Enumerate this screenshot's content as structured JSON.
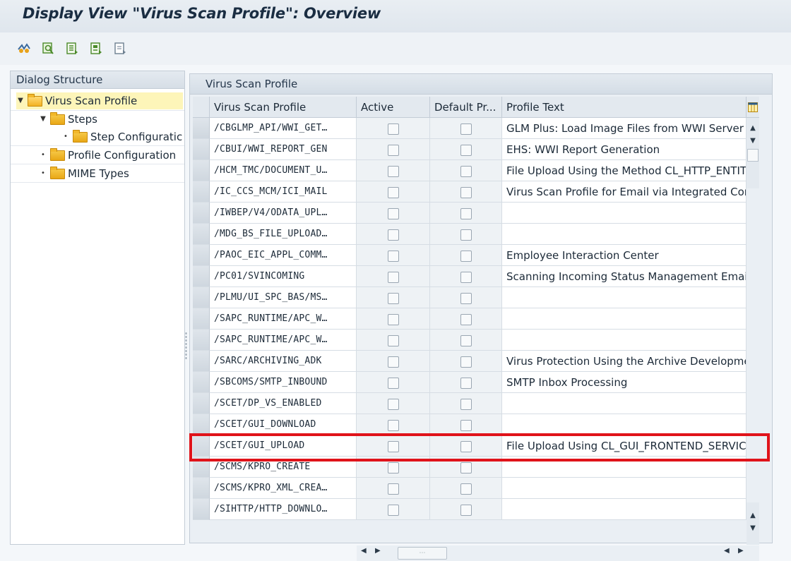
{
  "window": {
    "title": "Display View \"Virus Scan Profile\": Overview"
  },
  "toolbar": {
    "icons": [
      "other-view-icon",
      "details-icon",
      "select-all-icon",
      "select-block-icon",
      "deselect-all-icon"
    ]
  },
  "dialog_structure": {
    "header": "Dialog Structure",
    "items": [
      {
        "label": "Virus Scan Profile",
        "level": 0,
        "expanded": true,
        "selected": true
      },
      {
        "label": "Steps",
        "level": 1,
        "expanded": true,
        "selected": false
      },
      {
        "label": "Step Configuratic",
        "level": 2,
        "expanded": false,
        "selected": false
      },
      {
        "label": "Profile Configuration",
        "level": 1,
        "expanded": false,
        "selected": false
      },
      {
        "label": "MIME Types",
        "level": 1,
        "expanded": false,
        "selected": false
      }
    ]
  },
  "grid": {
    "panel_title": "Virus Scan Profile",
    "columns": [
      "Virus Scan Profile",
      "Active",
      "Default Pr...",
      "Profile Text"
    ],
    "rows": [
      {
        "profile": "/CBGLMP_API/WWI_GET…",
        "active": false,
        "default": false,
        "text": "GLM Plus: Load Image Files from WWI Server"
      },
      {
        "profile": "/CBUI/WWI_REPORT_GEN",
        "active": false,
        "default": false,
        "text": "EHS: WWI Report Generation"
      },
      {
        "profile": "/HCM_TMC/DOCUMENT_U…",
        "active": false,
        "default": false,
        "text": "File Upload Using the Method CL_HTTP_ENTIT"
      },
      {
        "profile": "/IC_CCS_MCM/ICI_MAIL",
        "active": false,
        "default": false,
        "text": "Virus Scan Profile for Email via Integrated Com"
      },
      {
        "profile": "/IWBEP/V4/ODATA_UPL…",
        "active": false,
        "default": false,
        "text": ""
      },
      {
        "profile": "/MDG_BS_FILE_UPLOAD…",
        "active": false,
        "default": false,
        "text": ""
      },
      {
        "profile": "/PAOC_EIC_APPL_COMM…",
        "active": false,
        "default": false,
        "text": "Employee Interaction Center"
      },
      {
        "profile": "/PC01/SVINCOMING",
        "active": false,
        "default": false,
        "text": "Scanning Incoming Status Management Emails"
      },
      {
        "profile": "/PLMU/UI_SPC_BAS/MS…",
        "active": false,
        "default": false,
        "text": ""
      },
      {
        "profile": "/SAPC_RUNTIME/APC_W…",
        "active": false,
        "default": false,
        "text": ""
      },
      {
        "profile": "/SAPC_RUNTIME/APC_W…",
        "active": false,
        "default": false,
        "text": ""
      },
      {
        "profile": "/SARC/ARCHIVING_ADK",
        "active": false,
        "default": false,
        "text": "Virus Protection Using the Archive Developme"
      },
      {
        "profile": "/SBCOMS/SMTP_INBOUND",
        "active": false,
        "default": false,
        "text": "SMTP Inbox Processing"
      },
      {
        "profile": "/SCET/DP_VS_ENABLED",
        "active": false,
        "default": false,
        "text": ""
      },
      {
        "profile": "/SCET/GUI_DOWNLOAD",
        "active": false,
        "default": false,
        "text": ""
      },
      {
        "profile": "/SCET/GUI_UPLOAD",
        "active": false,
        "default": false,
        "text": "File Upload Using CL_GUI_FRONTEND_SERVICI"
      },
      {
        "profile": "/SCMS/KPRO_CREATE",
        "active": false,
        "default": false,
        "text": ""
      },
      {
        "profile": "/SCMS/KPRO_XML_CREA…",
        "active": false,
        "default": false,
        "text": ""
      },
      {
        "profile": "/SIHTTP/HTTP_DOWNLO…",
        "active": false,
        "default": false,
        "text": ""
      }
    ],
    "highlighted_row_index": 15
  },
  "colors": {
    "highlight_border": "#e0131a",
    "tree_selection": "#fdf5b9",
    "folder": "#f3b224"
  }
}
